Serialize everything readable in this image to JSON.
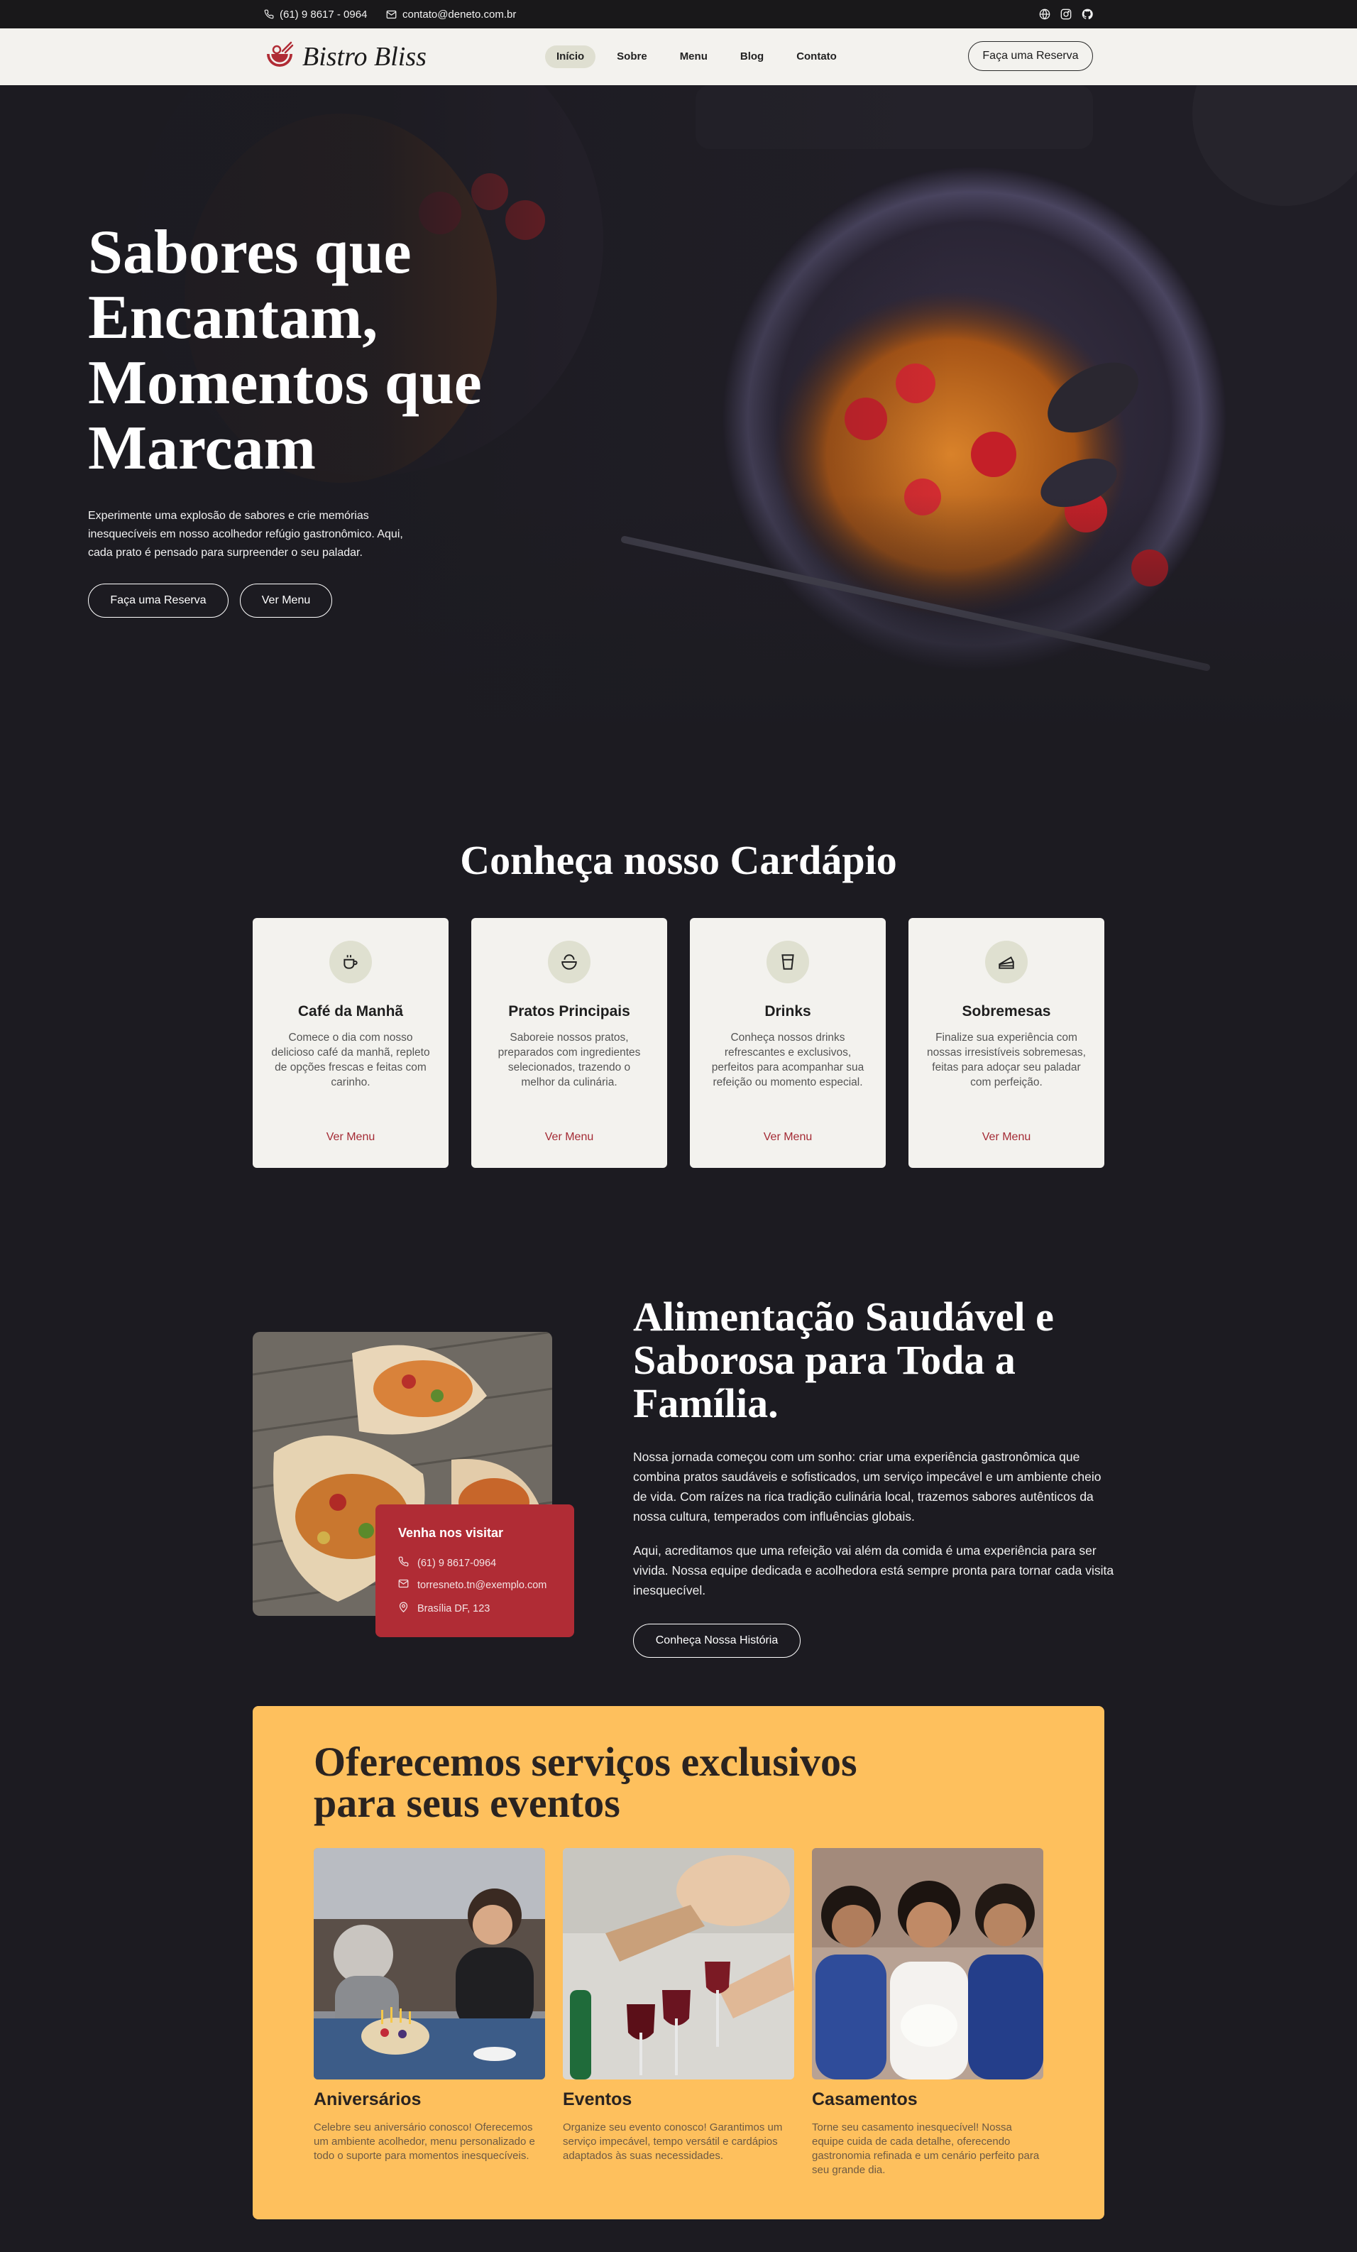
{
  "topbar": {
    "phone": "(61) 9 8617 - 0964",
    "email": "contato@deneto.com.br",
    "social_icons": [
      "globe-icon",
      "instagram-icon",
      "github-icon"
    ]
  },
  "header": {
    "logo_text": "Bistro Bliss",
    "nav": [
      {
        "label": "Início",
        "active": true
      },
      {
        "label": "Sobre",
        "active": false
      },
      {
        "label": "Menu",
        "active": false
      },
      {
        "label": "Blog",
        "active": false
      },
      {
        "label": "Contato",
        "active": false
      }
    ],
    "cta": "Faça uma Reserva"
  },
  "hero": {
    "title": "Sabores que Encantam, Momentos que Marcam",
    "subtitle": "Experimente uma explosão de sabores e crie memórias inesquecíveis em nosso acolhedor refúgio gastronômico. Aqui, cada prato é pensado para surpreender o seu paladar.",
    "primary_button": "Faça uma Reserva",
    "secondary_button": "Ver Menu"
  },
  "menu_section": {
    "title": "Conheça nosso Cardápio",
    "cards": [
      {
        "icon": "coffee-cup-icon",
        "title": "Café da Manhã",
        "description": "Comece o dia com nosso delicioso café da manhã, repleto de opções frescas e feitas com carinho.",
        "link": "Ver Menu"
      },
      {
        "icon": "bowl-icon",
        "title": "Pratos Principais",
        "description": "Saboreie nossos pratos, preparados com ingredientes selecionados, trazendo o melhor da culinária.",
        "link": "Ver Menu"
      },
      {
        "icon": "drink-glass-icon",
        "title": "Drinks",
        "description": "Conheça nossos drinks refrescantes e exclusivos, perfeitos para acompanhar sua refeição ou momento especial.",
        "link": "Ver Menu"
      },
      {
        "icon": "cake-slice-icon",
        "title": "Sobremesas",
        "description": "Finalize sua experiência com nossas irresistíveis sobremesas, feitas para adoçar seu paladar com perfeição.",
        "link": "Ver Menu"
      }
    ]
  },
  "about": {
    "title": "Alimentação Saudável e Saborosa para Toda a Família.",
    "paragraph1": "Nossa jornada começou com um sonho: criar uma experiência gastronômica que combina pratos saudáveis e sofisticados, um serviço impecável e um ambiente cheio de vida. Com raízes na rica tradição culinária local, trazemos sabores autênticos da nossa cultura, temperados com influências globais.",
    "paragraph2": "Aqui, acreditamos que uma refeição vai além da comida é uma experiência para ser vivida. Nossa equipe dedicada e acolhedora está sempre pronta para tornar cada visita inesquecível.",
    "button": "Conheça Nossa História",
    "visit_card": {
      "title": "Venha nos visitar",
      "phone": "(61) 9 8617-0964",
      "email": "torresneto.tn@exemplo.com",
      "address": "Brasília DF, 123"
    }
  },
  "events": {
    "title": "Oferecemos serviços exclusivos para seus eventos",
    "items": [
      {
        "title": "Aniversários",
        "description": "Celebre seu aniversário conosco! Oferecemos um ambiente acolhedor, menu personalizado e todo o suporte para momentos inesquecíveis."
      },
      {
        "title": "Eventos",
        "description": "Organize seu evento conosco! Garantimos um serviço impecável, tempo versátil e cardápios adaptados às suas necessidades."
      },
      {
        "title": "Casamentos",
        "description": "Torne seu casamento inesquecível! Nossa equipe cuida de cada detalhe, oferecendo gastronomia refinada e um cenário perfeito para seu grande dia."
      }
    ]
  },
  "colors": {
    "page_bg": "#1c1b21",
    "header_bg": "#f3f2ee",
    "accent_red": "#b02c35",
    "events_bg": "#fec05d"
  }
}
